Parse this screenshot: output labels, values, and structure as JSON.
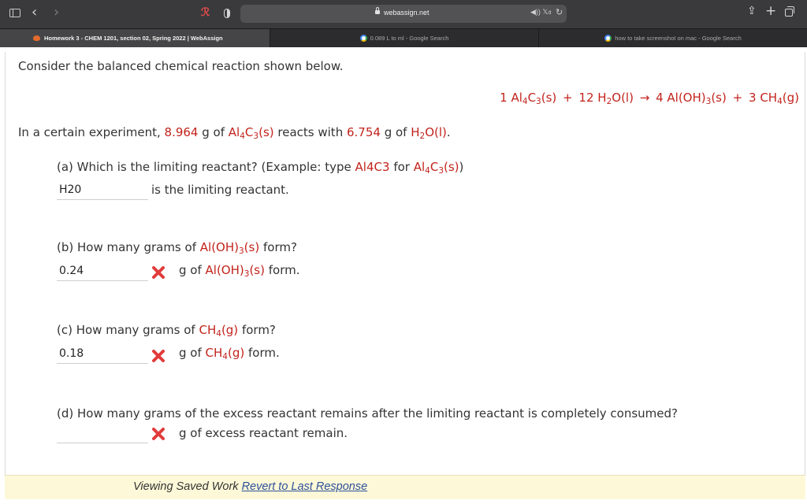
{
  "browser": {
    "url": "webassign.net",
    "audio_label": "◀︎)) 𝕏𝔞",
    "reload_icon": "reload-icon",
    "tabs": [
      {
        "label": "Homework 3 - CHEM 1201, section 02, Spring 2022 | WebAssign",
        "active": true
      },
      {
        "label": "0.089 L to ml - Google Search",
        "active": false
      },
      {
        "label": "how to take screenshot on mac - Google Search",
        "active": false
      }
    ]
  },
  "page": {
    "intro": "Consider the balanced chemical reaction shown below.",
    "equation": {
      "c1": "1",
      "r1a": "Al",
      "r1b": "4",
      "r1c": "C",
      "r1d": "3",
      "r1s": "(s)",
      "plus1": "+",
      "c2": "12",
      "r2a": "H",
      "r2b": "2",
      "r2c": "O",
      "r2s": "(l)",
      "arrow": "→",
      "c3": "4",
      "p1a": "Al(OH)",
      "p1b": "3",
      "p1s": "(s)",
      "plus2": "+",
      "c4": "3",
      "p2a": "CH",
      "p2b": "4",
      "p2s": "(g)"
    },
    "experiment": {
      "pre": "In a certain experiment,",
      "mass1": "8.964",
      "g1": "g of",
      "reactant1": {
        "a": "Al",
        "b": "4",
        "c": "C",
        "d": "3",
        "s": "(s)"
      },
      "mid": "reacts with",
      "mass2": "6.754",
      "g2": "g of",
      "reactant2": {
        "a": "H",
        "b": "2",
        "c": "O",
        "s": "(l)"
      },
      "end": "."
    },
    "parts": {
      "a": {
        "question_pre": "(a) Which is the limiting reactant? (Example: type",
        "example": "Al4C3",
        "question_for": "for",
        "ex_formula": {
          "a": "Al",
          "b": "4",
          "c": "C",
          "d": "3",
          "s": "(s)"
        },
        "question_close": ")",
        "answer": "H20",
        "after": "is the limiting reactant."
      },
      "b": {
        "question_pre": "(b) How many grams of",
        "formula": {
          "a": "Al(OH)",
          "b": "3",
          "s": "(s)"
        },
        "question_post": "form?",
        "answer": "0.24",
        "after_pre": "g of",
        "after_formula": {
          "a": "Al(OH)",
          "b": "3",
          "s": "(s)"
        },
        "after_post": "form."
      },
      "c": {
        "question_pre": "(c) How many grams of",
        "formula": {
          "a": "CH",
          "b": "4",
          "s": "(g)"
        },
        "question_post": "form?",
        "answer": "0.18",
        "after_pre": "g of",
        "after_formula": {
          "a": "CH",
          "b": "4",
          "s": "(g)"
        },
        "after_post": "form."
      },
      "d": {
        "question": "(d) How many grams of the excess reactant remains after the limiting reactant is completely consumed?",
        "answer": "",
        "after": "g of excess reactant remain."
      }
    },
    "footer": {
      "text": "Viewing Saved Work",
      "link": "Revert to Last Response"
    },
    "colors": {
      "accent_red": "#c2231c",
      "link_blue": "#2d4f9a",
      "footer_bg": "#fdf9d8",
      "incorrect_mark": "#e23b3b"
    }
  }
}
